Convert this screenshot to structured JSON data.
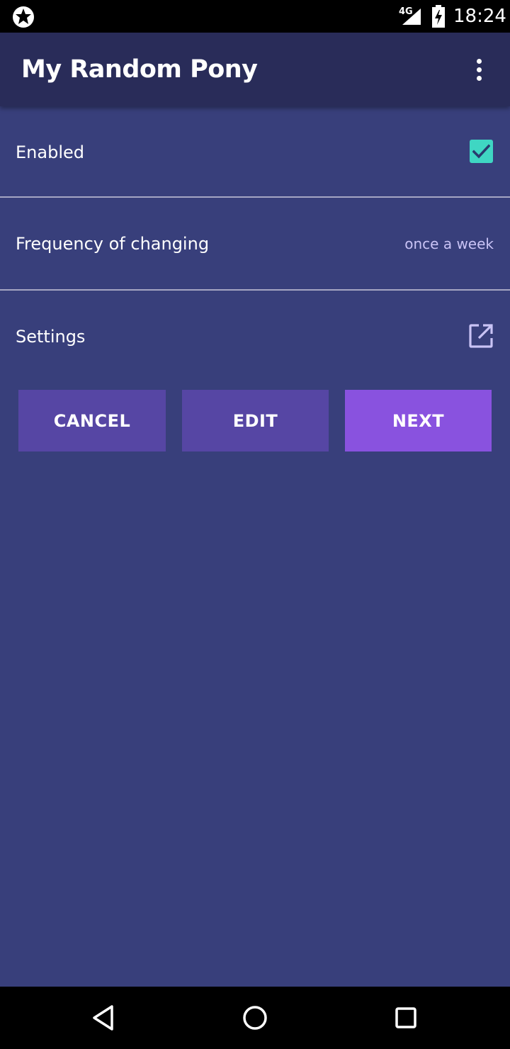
{
  "status_bar": {
    "network": "4G",
    "time": "18:24",
    "icons": [
      "app-notification-icon",
      "signal-icon",
      "battery-charging-icon"
    ]
  },
  "app_bar": {
    "title": "My Random Pony",
    "menu_icon": "more-vert-icon"
  },
  "preferences": {
    "enabled": {
      "label": "Enabled",
      "checked": true
    },
    "frequency": {
      "label": "Frequency of changing",
      "value": "once a week"
    },
    "settings": {
      "label": "Settings",
      "icon": "open-in-new-icon"
    }
  },
  "buttons": {
    "cancel": "CANCEL",
    "edit": "EDIT",
    "next": "NEXT"
  },
  "nav_bar": {
    "icons": [
      "back-icon",
      "home-icon",
      "recents-icon"
    ]
  },
  "colors": {
    "background": "#383f7b",
    "app_bar": "#292c59",
    "checkbox": "#3fd6c3",
    "button": "#5646a4",
    "button_primary": "#8952df"
  }
}
